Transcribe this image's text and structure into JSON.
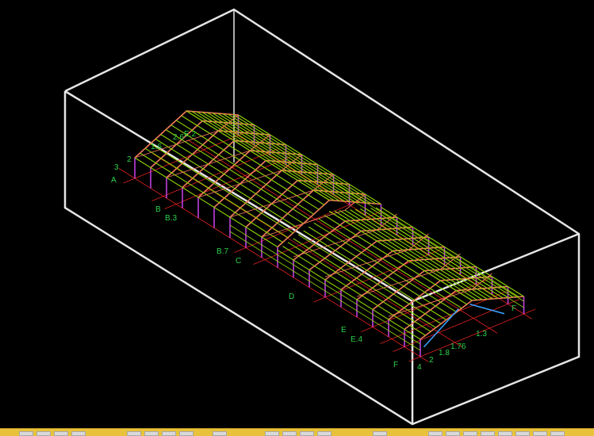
{
  "viewport": {
    "background": "#000000",
    "colors": {
      "bounding_box": "#e6e6e6",
      "gridline": "#e02020",
      "purlin": "#8fd400",
      "rafter": "#f07a5a",
      "column": "#c040e0",
      "brace": "#3aa0ff",
      "label": "#2bd24a"
    },
    "grid_labels": [
      {
        "id": "3",
        "text": "3"
      },
      {
        "id": "2",
        "text": "2"
      },
      {
        "id": "A",
        "text": "A"
      },
      {
        "id": "B",
        "text": "B"
      },
      {
        "id": "B3",
        "text": "B.3"
      },
      {
        "id": "B7",
        "text": "B.7"
      },
      {
        "id": "C",
        "text": "C"
      },
      {
        "id": "D",
        "text": "D"
      },
      {
        "id": "E",
        "text": "E"
      },
      {
        "id": "E4",
        "text": "E.4"
      },
      {
        "id": "F_lo",
        "text": "F"
      },
      {
        "id": "4",
        "text": "4"
      },
      {
        "id": "2b",
        "text": "2"
      },
      {
        "id": "18",
        "text": "1.8"
      },
      {
        "id": "176",
        "text": "1.76"
      },
      {
        "id": "13",
        "text": "1.3"
      },
      {
        "id": "F_hi",
        "text": "F"
      },
      {
        "id": "r1",
        "text": "1.6"
      },
      {
        "id": "r2",
        "text": "2.6"
      },
      {
        "id": "r3",
        "text": "E.2"
      }
    ]
  },
  "taskbar": {
    "color": "#e8c23a"
  }
}
